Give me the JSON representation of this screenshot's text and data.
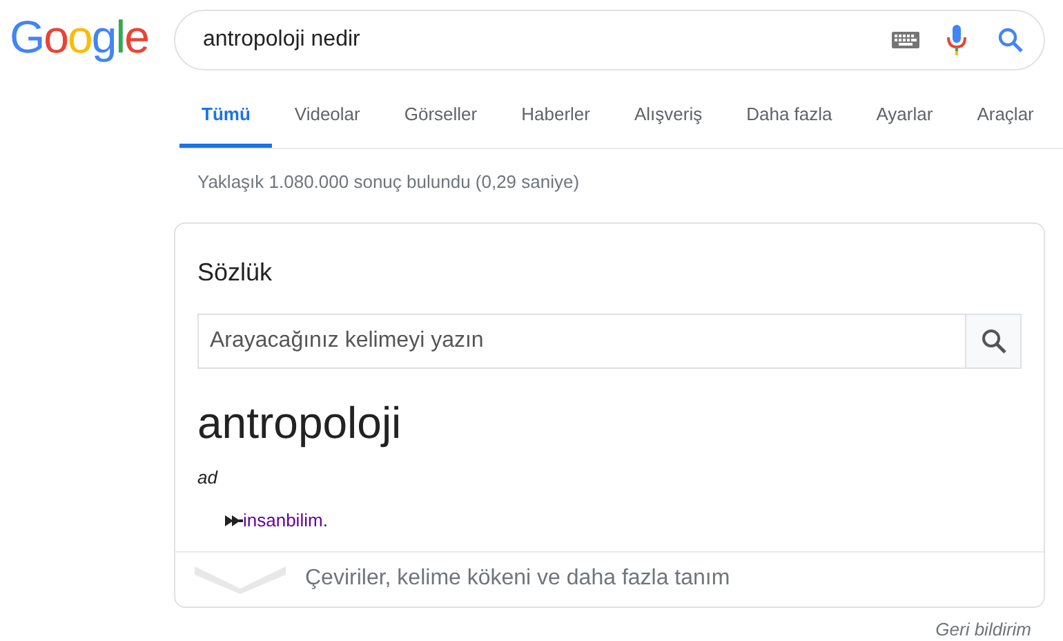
{
  "logo": "Google",
  "search": {
    "value": "antropoloji nedir"
  },
  "tabs": [
    {
      "label": "Tümü",
      "selected": true
    },
    {
      "label": "Videolar",
      "selected": false
    },
    {
      "label": "Görseller",
      "selected": false
    },
    {
      "label": "Haberler",
      "selected": false
    },
    {
      "label": "Alışveriş",
      "selected": false
    },
    {
      "label": "Daha fazla",
      "selected": false
    },
    {
      "label": "Ayarlar",
      "selected": false
    },
    {
      "label": "Araçlar",
      "selected": false
    }
  ],
  "result_stats": "Yaklaşık 1.080.000 sonuç bulundu (0,29 saniye)",
  "dictionary": {
    "title": "Sözlük",
    "search_placeholder": "Arayacağınız kelimeyi yazın",
    "word": "antropoloji",
    "part_of_speech": "ad",
    "definition_link": "insanbilim",
    "definition_end": ".",
    "more": "Çeviriler, kelime kökeni ve daha fazla tanım"
  },
  "feedback": "Geri bildirim"
}
